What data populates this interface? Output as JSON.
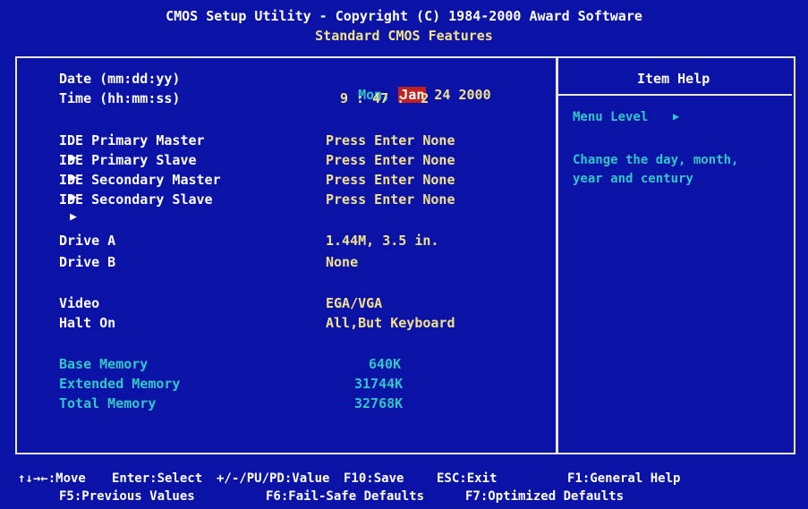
{
  "header": {
    "line1": "CMOS Setup Utility - Copyright (C) 1984-2000 Award Software",
    "line2": "Standard CMOS Features"
  },
  "settings": {
    "date_label": "Date (mm:dd:yy)",
    "date_dow": "Mon,",
    "date_month": "Jan",
    "date_rest": "24 2000",
    "time_label": "Time (hh:mm:ss)",
    "time_value": "9 : 47 :  2",
    "ide": [
      {
        "label": "IDE Primary Master",
        "value": "Press Enter None"
      },
      {
        "label": "IDE Primary Slave",
        "value": "Press Enter None"
      },
      {
        "label": "IDE Secondary Master",
        "value": "Press Enter None"
      },
      {
        "label": "IDE Secondary Slave",
        "value": "Press Enter None"
      }
    ],
    "drive_a_label": "Drive A",
    "drive_a_value": "1.44M, 3.5 in.",
    "drive_b_label": "Drive B",
    "drive_b_value": "None",
    "video_label": "Video",
    "video_value": "EGA/VGA",
    "halt_label": "Halt On",
    "halt_value": "All,But Keyboard",
    "base_mem_label": "Base Memory",
    "base_mem_value": "640K",
    "ext_mem_label": "Extended Memory",
    "ext_mem_value": "31744K",
    "total_mem_label": "Total Memory",
    "total_mem_value": "32768K"
  },
  "help": {
    "title": "Item Help",
    "menu_level": "Menu Level",
    "menu_level_marker": "▶",
    "text_line1": "Change the day, month,",
    "text_line2": "year and century"
  },
  "footer": {
    "move": "↑↓→←:Move",
    "enter": "Enter:Select",
    "value": "+/-/PU/PD:Value",
    "save": "F10:Save",
    "exit": "ESC:Exit",
    "general_help": "F1:General Help",
    "prev_values": "F5:Previous Values",
    "failsafe": "F6:Fail-Safe Defaults",
    "optimized": "F7:Optimized Defaults"
  },
  "colors": {
    "background": "#0a13a6",
    "value_text": "#f2e28c",
    "readonly_text": "#2fc7c7",
    "selection": "#c22121"
  }
}
